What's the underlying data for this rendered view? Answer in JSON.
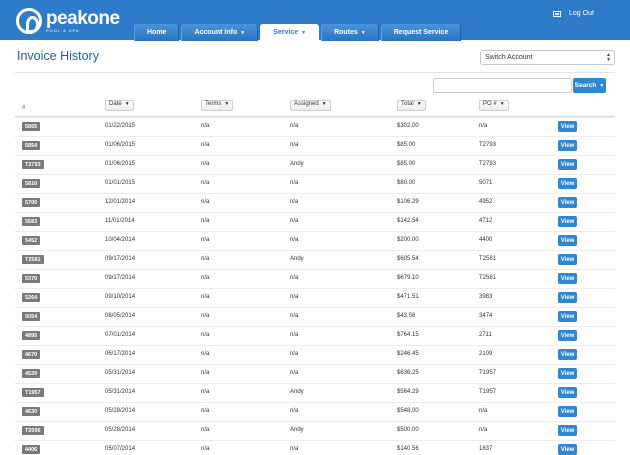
{
  "header": {
    "logo_name": "peakone",
    "logo_sub": "POOL & SPA",
    "nav": [
      {
        "label": "Home",
        "caret": ""
      },
      {
        "label": "Account Info",
        "caret": "▼"
      },
      {
        "label": "Service",
        "caret": "▼",
        "active": true
      },
      {
        "label": "Routes",
        "caret": "▼"
      },
      {
        "label": "Request Service",
        "caret": ""
      }
    ],
    "logout_label": "Log Out"
  },
  "page": {
    "title": "Invoice History",
    "switch_account": "Switch Account"
  },
  "search": {
    "placeholder": "",
    "button_label": "Search"
  },
  "table": {
    "hash": "#",
    "columns": [
      "Date",
      "Terms",
      "Assigned",
      "Total",
      "PO #"
    ],
    "view_label": "View",
    "rows": [
      {
        "id": "5865",
        "date": "01/22/2015",
        "terms": "n/a",
        "assigned": "n/a",
        "total": "$302.00",
        "po": "n/a"
      },
      {
        "id": "5854",
        "date": "01/06/2015",
        "terms": "n/a",
        "assigned": "n/a",
        "total": "$85.00",
        "po": "T2793"
      },
      {
        "id": "T2793",
        "date": "01/06/2015",
        "terms": "n/a",
        "assigned": "Andy",
        "total": "$85.00",
        "po": "T2793"
      },
      {
        "id": "5810",
        "date": "01/01/2015",
        "terms": "n/a",
        "assigned": "n/a",
        "total": "$80.00",
        "po": "5071"
      },
      {
        "id": "5700",
        "date": "12/01/2014",
        "terms": "n/a",
        "assigned": "n/a",
        "total": "$106.29",
        "po": "4952"
      },
      {
        "id": "5583",
        "date": "11/01/2014",
        "terms": "n/a",
        "assigned": "n/a",
        "total": "$142.54",
        "po": "4712"
      },
      {
        "id": "5452",
        "date": "10/04/2014",
        "terms": "n/a",
        "assigned": "n/a",
        "total": "$200.00",
        "po": "4400"
      },
      {
        "id": "T2581",
        "date": "09/17/2014",
        "terms": "n/a",
        "assigned": "Andy",
        "total": "$605.54",
        "po": "T2581"
      },
      {
        "id": "5370",
        "date": "09/17/2014",
        "terms": "n/a",
        "assigned": "n/a",
        "total": "$679.10",
        "po": "T2581"
      },
      {
        "id": "5264",
        "date": "09/10/2014",
        "terms": "n/a",
        "assigned": "n/a",
        "total": "$471.51",
        "po": "3983"
      },
      {
        "id": "5054",
        "date": "08/05/2014",
        "terms": "n/a",
        "assigned": "n/a",
        "total": "$43.56",
        "po": "3474"
      },
      {
        "id": "4895",
        "date": "07/01/2014",
        "terms": "n/a",
        "assigned": "n/a",
        "total": "$764.15",
        "po": "2711"
      },
      {
        "id": "4670",
        "date": "06/17/2014",
        "terms": "n/a",
        "assigned": "n/a",
        "total": "$246.45",
        "po": "2109"
      },
      {
        "id": "4539",
        "date": "05/31/2014",
        "terms": "n/a",
        "assigned": "n/a",
        "total": "$636.25",
        "po": "T1957"
      },
      {
        "id": "T1957",
        "date": "05/31/2014",
        "terms": "n/a",
        "assigned": "Andy",
        "total": "$564.29",
        "po": "T1957"
      },
      {
        "id": "4630",
        "date": "05/28/2014",
        "terms": "n/a",
        "assigned": "n/a",
        "total": "$548.00",
        "po": "n/a"
      },
      {
        "id": "T2096",
        "date": "05/28/2014",
        "terms": "n/a",
        "assigned": "Andy",
        "total": "$500.00",
        "po": "n/a"
      },
      {
        "id": "4406",
        "date": "05/07/2014",
        "terms": "n/a",
        "assigned": "n/a",
        "total": "$140.56",
        "po": "1837"
      }
    ]
  },
  "colors": {
    "brand_blue": "#2e7cc9",
    "button_blue": "#2f86d3",
    "badge_gray": "#7a7a7a",
    "title_blue": "#1f5f9e"
  }
}
